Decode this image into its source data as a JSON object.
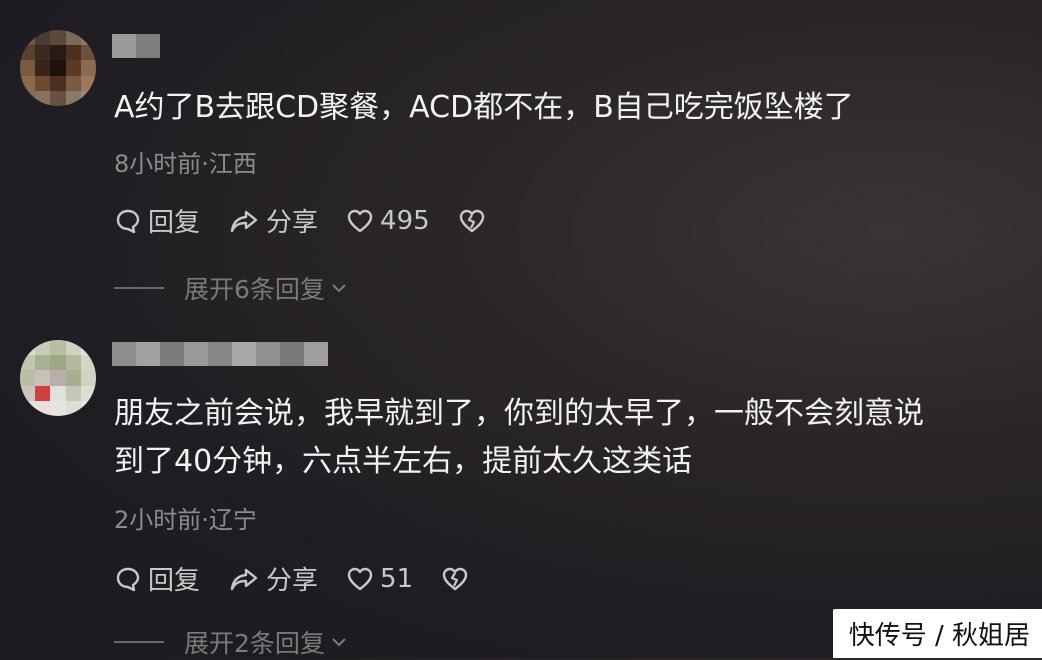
{
  "comments": [
    {
      "text": "A约了B去跟CD聚餐，ACD都不在，B自己吃完饭坠楼了",
      "meta": "8小时前·江西",
      "reply_label": "回复",
      "share_label": "分享",
      "likes": "495",
      "expand_label": "展开6条回复"
    },
    {
      "text": "朋友之前会说，我早就到了，你到的太早了，一般不会刻意说\n到了40分钟，六点半左右，提前太久这类话",
      "meta": "2小时前·辽宁",
      "reply_label": "回复",
      "share_label": "分享",
      "likes": "51",
      "expand_label": "展开2条回复"
    }
  ],
  "watermark": "快传号 / 秋姐居",
  "icons": [
    "reply-icon",
    "share-icon",
    "heart-icon",
    "broken-heart-icon",
    "chevron-down-icon"
  ],
  "colors": {
    "background": "#232126",
    "text": "#f2f2f2",
    "meta": "#8c8c8c",
    "action": "#c8c8c8",
    "expand": "#7a7a7a"
  }
}
